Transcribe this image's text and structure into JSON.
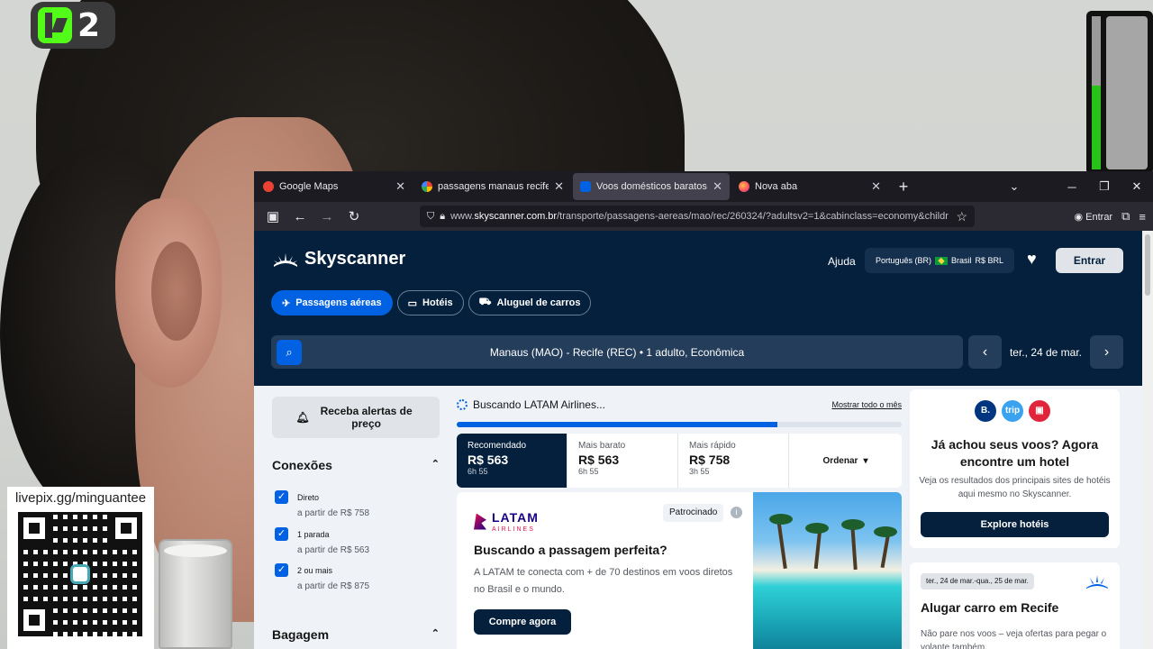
{
  "overlay": {
    "kick_badge": "2",
    "pix_text": "livepix.gg/minguantee",
    "audio_meter_level": 0.55
  },
  "browser": {
    "tabs": [
      {
        "title": "Google Maps",
        "icon": "google-maps-icon",
        "active": false
      },
      {
        "title": "passagens manaus recife - Pesq",
        "icon": "google-icon",
        "active": false
      },
      {
        "title": "Voos domésticos baratos de/pa",
        "icon": "skyscanner-icon",
        "active": true
      },
      {
        "title": "Nova aba",
        "icon": "firefox-icon",
        "active": false
      }
    ],
    "url_prefix": "www.",
    "url_domain": "skyscanner.com.br",
    "url_path": "/transporte/passagens-aereas/mao/rec/260324/?adultsv2=1&cabinclass=economy&childr",
    "account_label": "Entrar"
  },
  "header": {
    "brand": "Skyscanner",
    "help": "Ajuda",
    "locale": "Português (BR)",
    "country": "Brasil",
    "currency": "R$ BRL",
    "login": "Entrar"
  },
  "nav_pills": [
    {
      "label": "Passagens aéreas",
      "icon": "plane-icon",
      "active": true
    },
    {
      "label": "Hotéis",
      "icon": "bed-icon",
      "active": false
    },
    {
      "label": "Aluguel de carros",
      "icon": "car-icon",
      "active": false
    }
  ],
  "search": {
    "route": "Manaus (MAO) - Recife (REC)",
    "separator": "•",
    "travellers": "1 adulto, Econômica",
    "date": "ter., 24 de mar."
  },
  "filters": {
    "alert_button": "Receba alertas de preço",
    "connections_title": "Conexões",
    "options": [
      {
        "label": "Direto",
        "price": "a partir de R$ 758",
        "checked": true
      },
      {
        "label": "1 parada",
        "price": "a partir de R$ 563",
        "checked": true
      },
      {
        "label": "2 ou mais",
        "price": "a partir de R$ 875",
        "checked": true
      }
    ],
    "baggage_title": "Bagagem"
  },
  "results": {
    "status": "Buscando LATAM Airlines...",
    "show_month": "Mostrar todo o mês",
    "progress": 0.72,
    "sorts": [
      {
        "label": "Recomendado",
        "price": "R$ 563",
        "duration": "6h 55",
        "active": true
      },
      {
        "label": "Mais barato",
        "price": "R$ 563",
        "duration": "6h 55",
        "active": false
      },
      {
        "label": "Mais rápido",
        "price": "R$ 758",
        "duration": "3h 55",
        "active": false
      }
    ],
    "sort_menu": "Ordenar"
  },
  "ad": {
    "brand": "LATAM",
    "brand_sub": "AIRLINES",
    "sponsored": "Patrocinado",
    "title": "Buscando a passagem perfeita?",
    "description": "A LATAM te conecta com + de 70 destinos em voos diretos no Brasil e o mundo.",
    "cta": "Compre agora"
  },
  "hotel_card": {
    "logos": [
      {
        "text": "B.",
        "color": "#003580"
      },
      {
        "text": "trip",
        "color": "#3aa3f0"
      },
      {
        "text": "",
        "color": "#e0243a"
      }
    ],
    "title": "Já achou seus voos? Agora encontre um hotel",
    "description": "Veja os resultados dos principais sites de hotéis aqui mesmo no Skyscanner.",
    "cta": "Explore hotéis"
  },
  "car_card": {
    "dates": "ter., 24 de mar.-qua., 25 de mar.",
    "title": "Alugar carro em Recife",
    "description": "Não pare nos voos – veja ofertas para pegar o volante também."
  },
  "colors": {
    "brand_navy": "#05203c",
    "brand_blue": "#0062e3",
    "page_bg": "#eff3f8"
  }
}
